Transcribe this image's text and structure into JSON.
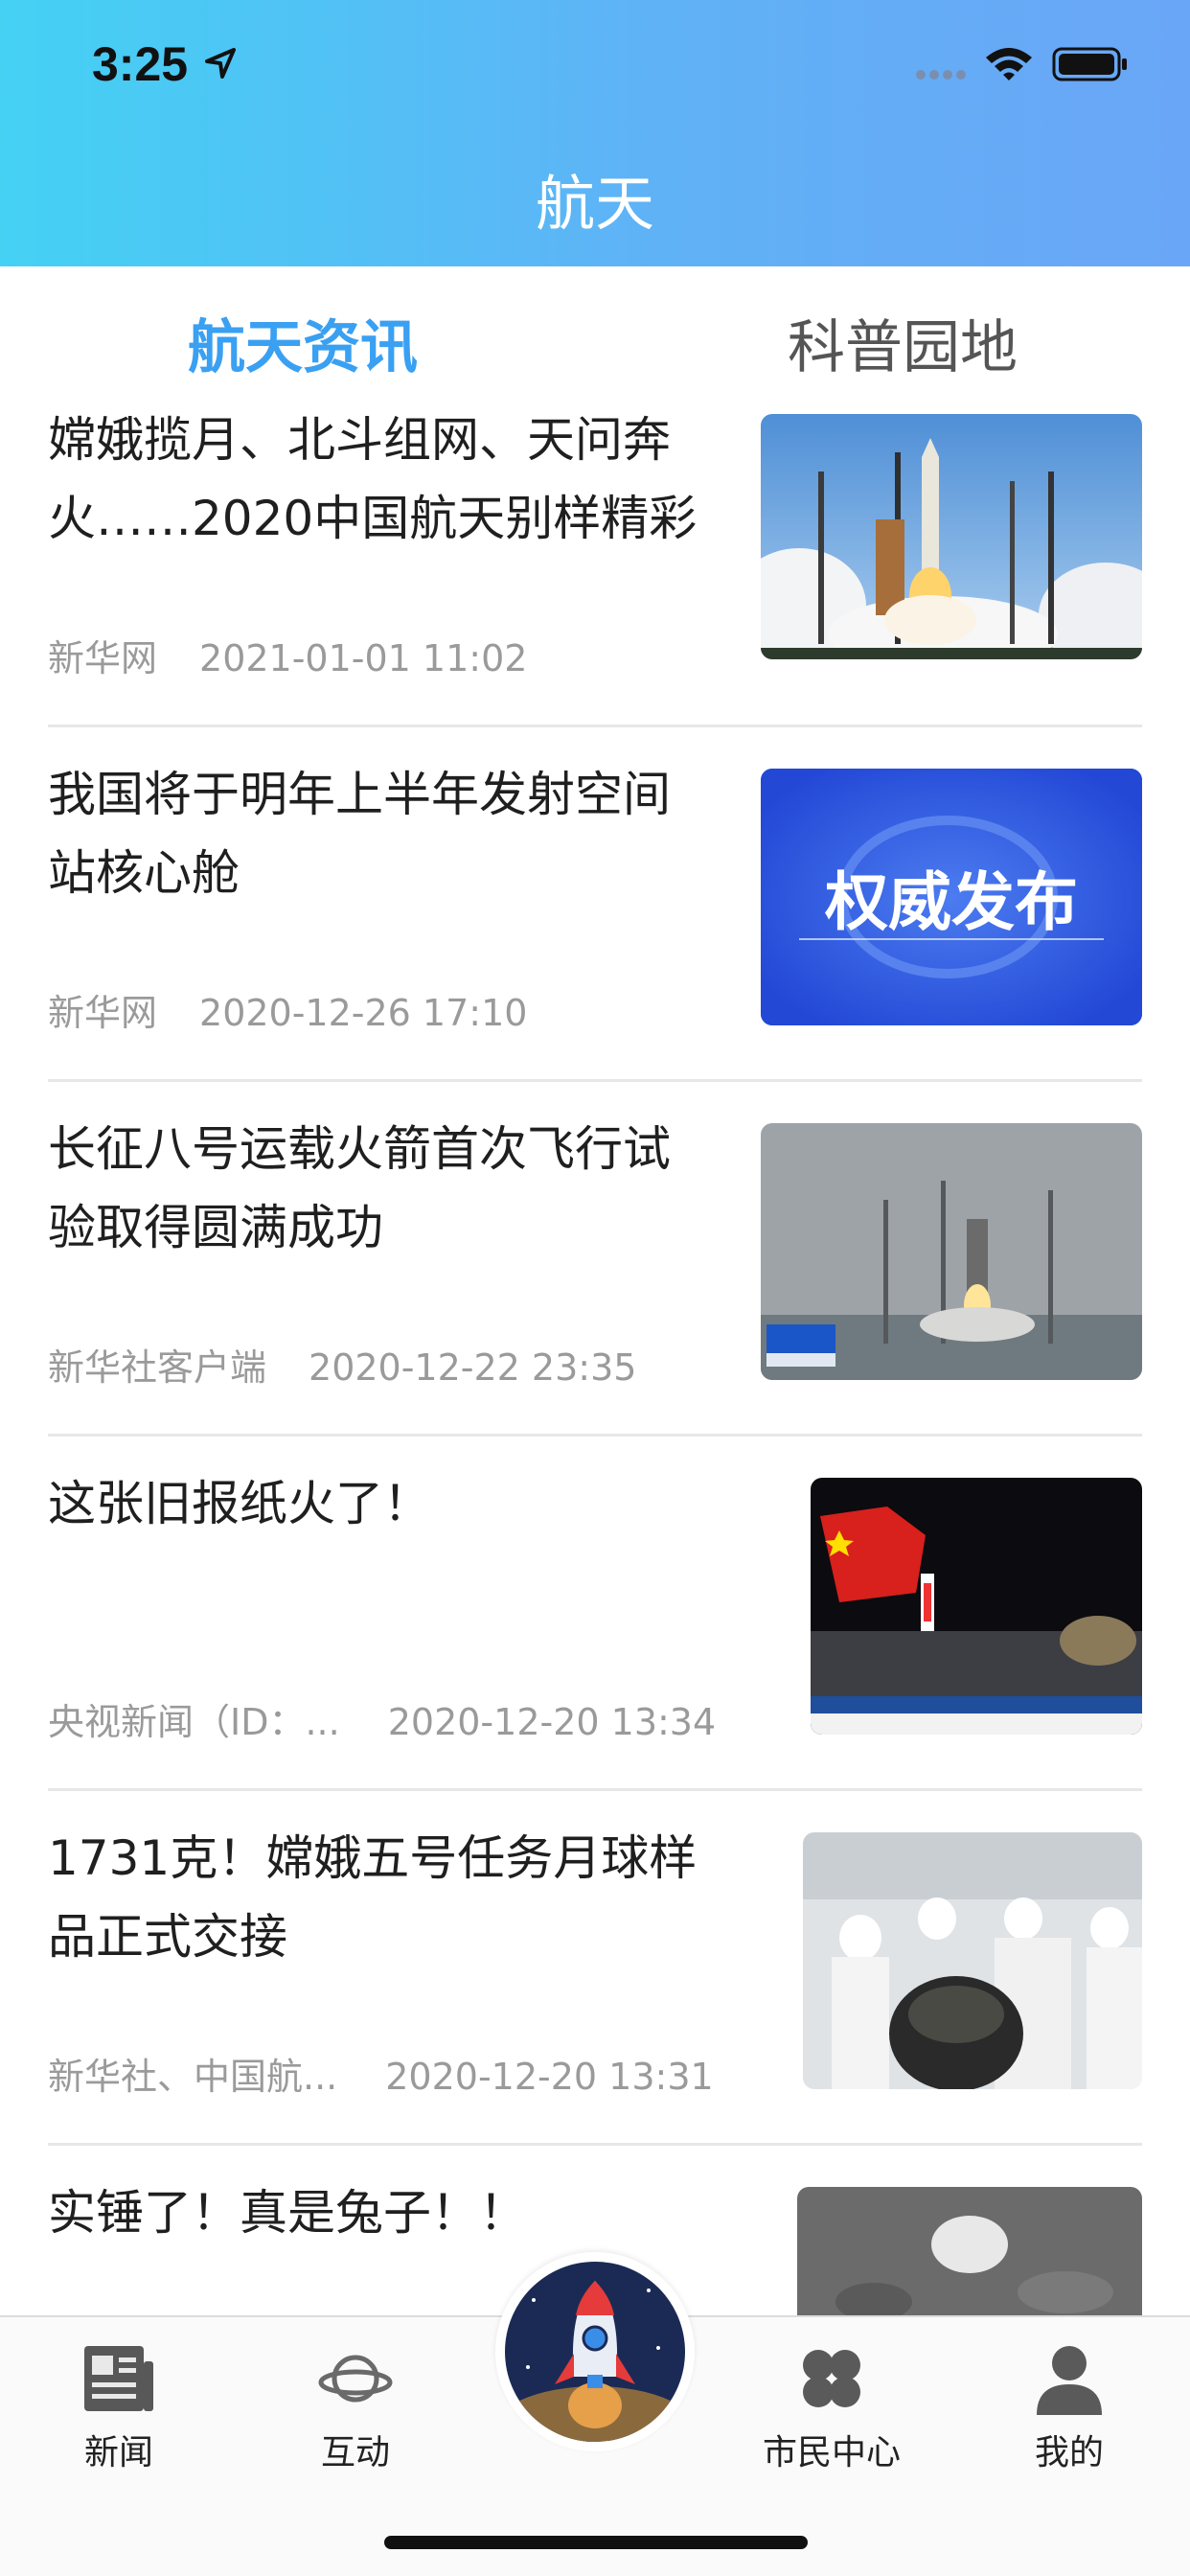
{
  "status_bar": {
    "time": "3:25"
  },
  "header": {
    "title": "航天"
  },
  "tabs": [
    {
      "label": "航天资讯",
      "active": true
    },
    {
      "label": "科普园地",
      "active": false
    }
  ],
  "news": [
    {
      "title": "嫦娥揽月、北斗组网、天问奔火……2020中国航天别样精彩",
      "source": "新华网",
      "time": "2021-01-01 11:02",
      "thumb": "rocket-launch-image"
    },
    {
      "title": "我国将于明年上半年发射空间站核心舱",
      "source": "新华网",
      "time": "2020-12-26 17:10",
      "thumb": "authority-release-image",
      "thumb_text": "权威发布"
    },
    {
      "title": "长征八号运载火箭首次飞行试验取得圆满成功",
      "source": "新华社客户端",
      "time": "2020-12-22 23:35",
      "thumb": "long-march-8-image"
    },
    {
      "title": "这张旧报纸火了！",
      "source": "央视新闻（ID：...",
      "time": "2020-12-20 13:34",
      "thumb": "change5-return-image"
    },
    {
      "title": "1731克！嫦娥五号任务月球样品正式交接",
      "source": "新华社、中国航...",
      "time": "2020-12-20 13:31",
      "thumb": "sample-handover-image"
    },
    {
      "title": "实锤了！真是兔子！！",
      "source": "",
      "time": "",
      "thumb": "moon-surface-image"
    }
  ],
  "tabbar": [
    {
      "label": "新闻",
      "icon": "newspaper-icon"
    },
    {
      "label": "互动",
      "icon": "planet-icon"
    },
    {
      "label": "",
      "icon": "rocket-icon"
    },
    {
      "label": "市民中心",
      "icon": "clover-icon"
    },
    {
      "label": "我的",
      "icon": "person-icon"
    }
  ],
  "colors": {
    "accent": "#3aa0f2",
    "header_start": "#44d1f4",
    "header_end": "#6aa6f7"
  }
}
